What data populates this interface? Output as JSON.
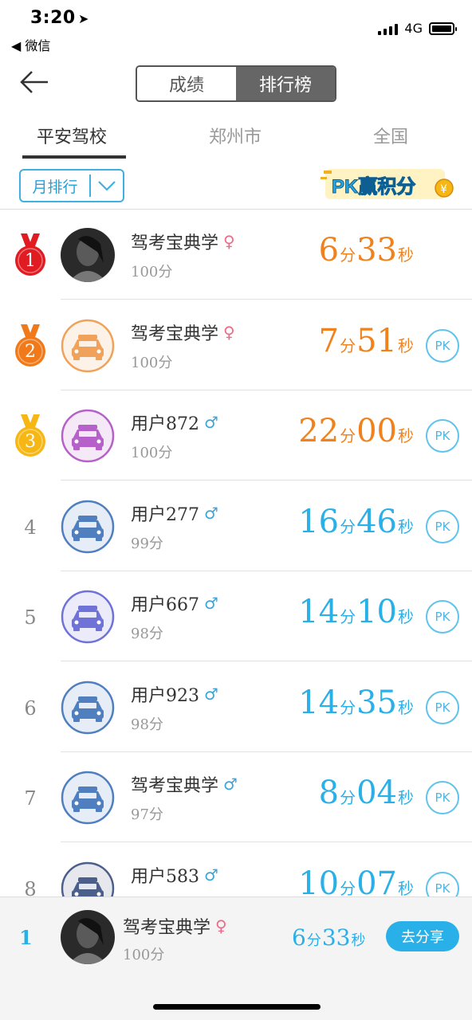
{
  "status_bar": {
    "time": "3:20",
    "back_app": "◀ 微信",
    "network": "4G"
  },
  "nav": {
    "segments": [
      {
        "label": "成绩",
        "active": false
      },
      {
        "label": "排行榜",
        "active": true
      }
    ]
  },
  "tabs": [
    {
      "label": "平安驾校",
      "active": true
    },
    {
      "label": "郑州市",
      "active": false
    },
    {
      "label": "全国",
      "active": false
    }
  ],
  "filter": {
    "label": "月排行"
  },
  "pk_badge": {
    "text": "PK赢积分"
  },
  "rows": [
    {
      "rank": "1",
      "medal": "red",
      "avatar": "photo-avatar",
      "name": "驾考宝典学",
      "gender": "♀",
      "gender_type": "f",
      "score": "100分",
      "min": "6",
      "min_unit": "分",
      "sec": "33",
      "sec_unit": "秒",
      "time_color": "orange",
      "pk": ""
    },
    {
      "rank": "2",
      "medal": "orange",
      "avatar": "car-orange",
      "name": "驾考宝典学",
      "gender": "♀",
      "gender_type": "f",
      "score": "100分",
      "min": "7",
      "min_unit": "分",
      "sec": "51",
      "sec_unit": "秒",
      "time_color": "orange",
      "pk": "PK"
    },
    {
      "rank": "3",
      "medal": "gold",
      "avatar": "car-purple",
      "name": "用户872",
      "gender": "♂",
      "gender_type": "m",
      "score": "100分",
      "min": "22",
      "min_unit": "分",
      "sec": "00",
      "sec_unit": "秒",
      "time_color": "orange",
      "pk": "PK"
    },
    {
      "rank": "4",
      "medal": "",
      "avatar": "car-steel",
      "name": "用户277",
      "gender": "♂",
      "gender_type": "m",
      "score": "99分",
      "min": "16",
      "min_unit": "分",
      "sec": "46",
      "sec_unit": "秒",
      "time_color": "blue",
      "pk": "PK"
    },
    {
      "rank": "5",
      "medal": "",
      "avatar": "car-violet",
      "name": "用户667",
      "gender": "♂",
      "gender_type": "m",
      "score": "98分",
      "min": "14",
      "min_unit": "分",
      "sec": "10",
      "sec_unit": "秒",
      "time_color": "blue",
      "pk": "PK"
    },
    {
      "rank": "6",
      "medal": "",
      "avatar": "car-steel",
      "name": "用户923",
      "gender": "♂",
      "gender_type": "m",
      "score": "98分",
      "min": "14",
      "min_unit": "分",
      "sec": "35",
      "sec_unit": "秒",
      "time_color": "blue",
      "pk": "PK"
    },
    {
      "rank": "7",
      "medal": "",
      "avatar": "car-steel",
      "name": "驾考宝典学",
      "gender": "♂",
      "gender_type": "m",
      "score": "97分",
      "min": "8",
      "min_unit": "分",
      "sec": "04",
      "sec_unit": "秒",
      "time_color": "blue",
      "pk": "PK"
    },
    {
      "rank": "8",
      "medal": "",
      "avatar": "car-navy",
      "name": "用户583",
      "gender": "♂",
      "gender_type": "m",
      "score": "",
      "min": "10",
      "min_unit": "分",
      "sec": "07",
      "sec_unit": "秒",
      "time_color": "blue",
      "pk": "PK"
    }
  ],
  "colors": {
    "orange": "#f0821e",
    "blue": "#2ab0e8",
    "medal_red": "#e11b22",
    "medal_orange": "#f07a1a",
    "medal_gold": "#f6b715",
    "car-orange": "#f0a15a",
    "car-purple": "#b561c9",
    "car-steel": "#4f7fbf",
    "car-violet": "#6f72d6",
    "car-navy": "#4c5e8a"
  },
  "my_rank": {
    "rank": "1",
    "name": "驾考宝典学",
    "gender": "♀",
    "score": "100分",
    "min": "6",
    "min_unit": "分",
    "sec": "33",
    "sec_unit": "秒",
    "share_label": "去分享"
  }
}
